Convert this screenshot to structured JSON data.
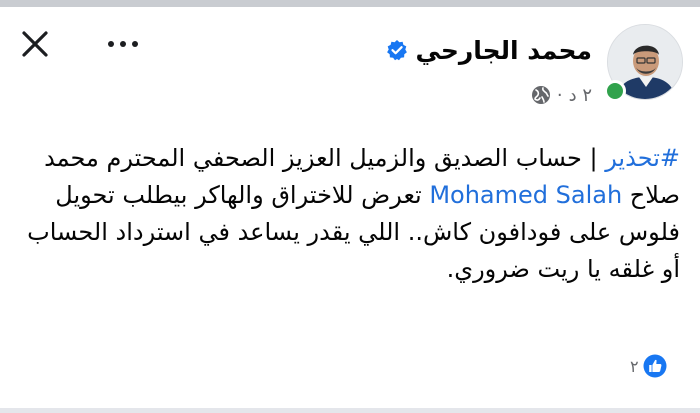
{
  "post": {
    "author_name": "محمد الجارحي",
    "time": "٢ د",
    "time_separator": "·",
    "hashtag": "#تحذير",
    "text_part1": " | حساب الصديق والزميل العزيز الصحفي المحترم محمد صلاح ",
    "mention": "Mohamed Salah",
    "text_part2": " تعرض للاختراق والهاكر بيطلب تحويل فلوس على فودافون كاش.. اللي يقدر يساعد في استرداد الحساب أو غلقه يا ريت ضروري.",
    "like_count": "٢"
  },
  "icons": {
    "close": "close-icon",
    "more": "more-horizontal-icon",
    "verified": "verified-badge-icon",
    "privacy": "globe-icon",
    "like": "like-reaction-icon"
  },
  "colors": {
    "link": "#216fdb",
    "verified": "#1877f2",
    "online": "#31a24c",
    "secondary_text": "#65676b"
  }
}
